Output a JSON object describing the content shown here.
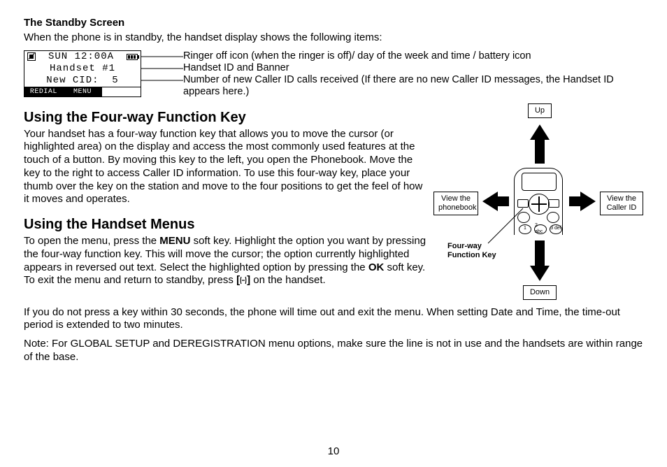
{
  "standby": {
    "heading": "The Standby Screen",
    "intro": "When the phone is in standby, the handset display shows the following items:",
    "lcd": {
      "line1_time": "SUN 12:00A",
      "line2": "Handset #1",
      "line3": "New CID:  5",
      "soft_left": "REDIAL",
      "soft_mid": "MENU",
      "soft_right": ""
    },
    "callouts": {
      "c1": "Ringer off icon (when the ringer is off)/ day of the week and time / battery icon",
      "c2": "Handset ID and Banner",
      "c3": "Number of new Caller ID calls received (If there are no new Caller ID messages, the Handset ID appears here.)"
    }
  },
  "fourway": {
    "heading": "Using the Four-way Function Key",
    "body": "Your handset has a four-way function key that allows you to move the cursor (or highlighted area) on the display and access the most commonly used features at the touch of a button. By moving this key to the left, you open the Phonebook. Move the key to the right to access Caller ID information. To use this four-way key, place your thumb over the key on the station and move to the four positions to get the feel of how it moves and operates."
  },
  "menus": {
    "heading": "Using the Handset Menus",
    "p1_a": "To open the menu, press the ",
    "p1_menu": "MENU",
    "p1_b": " soft key. Highlight the option you want by pressing the four-way function key. This will move the cursor; the option currently highlighted appears in reversed out text. Select the highlighted option by pressing the ",
    "p1_ok": "OK",
    "p1_c": " soft key. To exit the menu and return to standby, press ",
    "p1_d": " on the handset.",
    "p2": "If you do not press a key within 30 seconds, the phone will time out and exit the menu. When setting Date and Time, the time-out period is extended to two minutes.",
    "p3": "Note: For GLOBAL SETUP and DEREGISTRATION menu options, make sure the line is not in use and the handsets are within range of the base."
  },
  "diagram": {
    "up": "Up",
    "down": "Down",
    "left_a": "View the",
    "left_b": "phonebook",
    "right_a": "View the",
    "right_b": "Caller ID",
    "label_a": "Four-way",
    "label_b": "Function Key",
    "keys": {
      "k1": "1",
      "k2": "2 abc",
      "k3": "3 def"
    }
  },
  "page_number": "10"
}
